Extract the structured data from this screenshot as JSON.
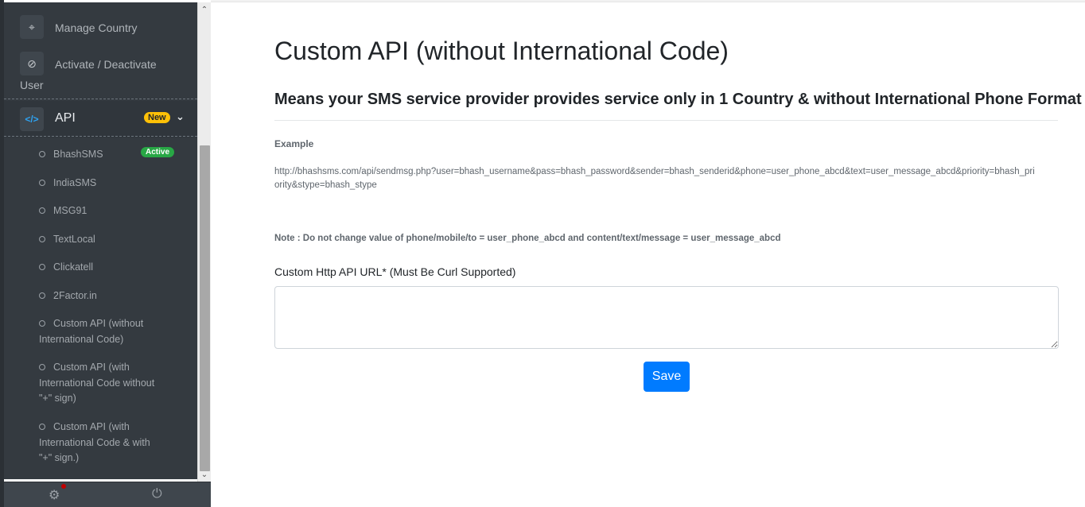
{
  "sidebar": {
    "items": [
      {
        "label": "Manage Country",
        "icon": "crosshair-icon"
      },
      {
        "label": "Activate / Deactivate",
        "label_line2": "User",
        "icon": "ban-icon"
      }
    ],
    "api": {
      "label": "API",
      "icon": "code-icon",
      "badge": "New",
      "sub_items": [
        {
          "label": "BhashSMS",
          "badge": "Active"
        },
        {
          "label": "IndiaSMS"
        },
        {
          "label": "MSG91"
        },
        {
          "label": "TextLocal"
        },
        {
          "label": "Clickatell"
        },
        {
          "label": "2Factor.in"
        },
        {
          "label": "Custom API (without",
          "label_line2": "International Code)"
        },
        {
          "label": "Custom API (with",
          "label_line2": "International Code without",
          "label_line3": "\"+\" sign)"
        },
        {
          "label": "Custom API (with",
          "label_line2": "International Code & with",
          "label_line3": "\"+\" sign.)"
        }
      ]
    }
  },
  "colors": {
    "sidebar_bg": "#343a40",
    "primary": "#007bff",
    "badge_new": "#ffc107",
    "badge_active": "#28a745",
    "notification_dot": "#c00000"
  },
  "main": {
    "title": "Custom API (without International Code)",
    "subtitle": "Means your SMS service provider provides service only in 1 Country & without International Phone Format",
    "example_label": "Example",
    "example_url": "http://bhashsms.com/api/sendmsg.php?user=bhash_username&pass=bhash_password&sender=bhash_senderid&phone=user_phone_abcd&text=user_message_abcd&priority=bhash_priority&stype=bhash_stype",
    "note": "Note : Do not change value of phone/mobile/to = user_phone_abcd and content/text/message = user_message_abcd",
    "field_label": "Custom Http API URL* (Must Be Curl Supported)",
    "field_value": "",
    "save_label": "Save"
  }
}
